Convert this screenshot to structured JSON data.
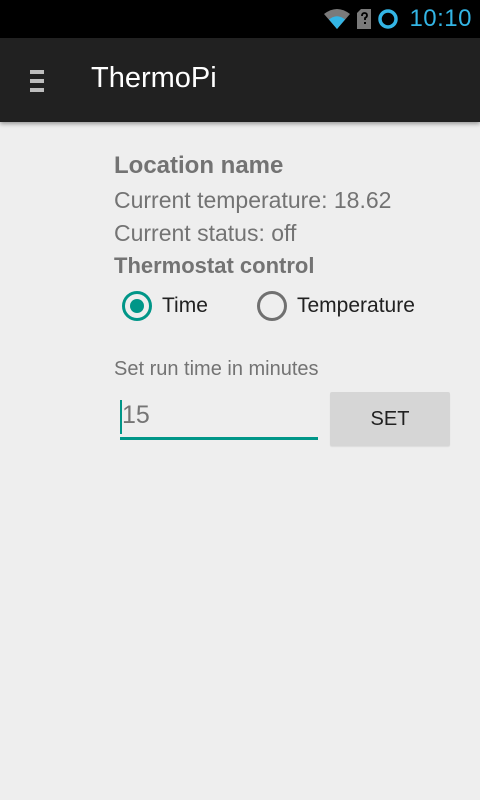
{
  "status_bar": {
    "time": "10:10",
    "icons": [
      "wifi-icon",
      "sim-unknown-icon",
      "sync-ring-icon"
    ],
    "accent_color": "#33b5e5"
  },
  "action_bar": {
    "title": "ThermoPi",
    "menu_icon": "menu-icon"
  },
  "main": {
    "location_name": "Location name",
    "current_temperature": "Current temperature: 18.62",
    "current_status": "Current status: off",
    "thermostat_control_title": "Thermostat control",
    "mode_options": [
      {
        "label": "Time",
        "selected": true
      },
      {
        "label": "Temperature",
        "selected": false
      }
    ],
    "run_time_label": "Set run time in minutes",
    "minutes_value": "15",
    "set_button_label": "SET"
  },
  "colors": {
    "accent": "#009688",
    "action_bar": "#212121",
    "background": "#eeeeee"
  }
}
